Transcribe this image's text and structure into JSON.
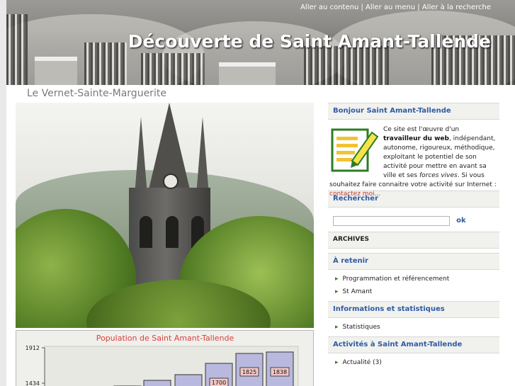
{
  "header": {
    "skip_links": [
      "Aller au contenu",
      "Aller au menu",
      "Aller à la recherche"
    ],
    "separator": "|",
    "site_title": "Découverte de Saint Amant-Tallende"
  },
  "subtitle": "Le Vernet-Sainte-Marguerite",
  "chart_data": {
    "type": "bar",
    "title": "Population de Saint Amant-Tallende",
    "ytick_labels": [
      "1912",
      "1434"
    ],
    "data_labels": [
      "1700",
      "1825",
      "1838"
    ],
    "colors": {
      "title": "#d9413a",
      "bar": "#b9b9df",
      "label_bg": "#f3c7c7"
    }
  },
  "sidebar": {
    "hello_title": "Bonjour Saint Amant-Tallende",
    "intro": {
      "p1": "Ce site est l'œuvre d'un ",
      "b1": "travailleur du web",
      "p2": ", indépendant, autonome, rigoureux, méthodique, exploitant le potentiel de son activité pour mettre en avant sa ville et ses ",
      "i1": "forces vives",
      "p3": ". Si vous souhaitez faire connaitre votre activité sur Internet : ",
      "link": "contactez moi..."
    },
    "search_title": "Rechercher",
    "search_placeholder": "",
    "search_button": "ok",
    "archives_title": "ARCHIVES",
    "retenir_title": "À retenir",
    "retenir_items": [
      "Programmation et référencement",
      "St Amant"
    ],
    "info_title": "Informations et statistiques",
    "info_items": [
      "Statistiques"
    ],
    "activites_title": "Activités à Saint Amant-Tallende",
    "activites_items": [
      "Actualité (3)"
    ]
  }
}
